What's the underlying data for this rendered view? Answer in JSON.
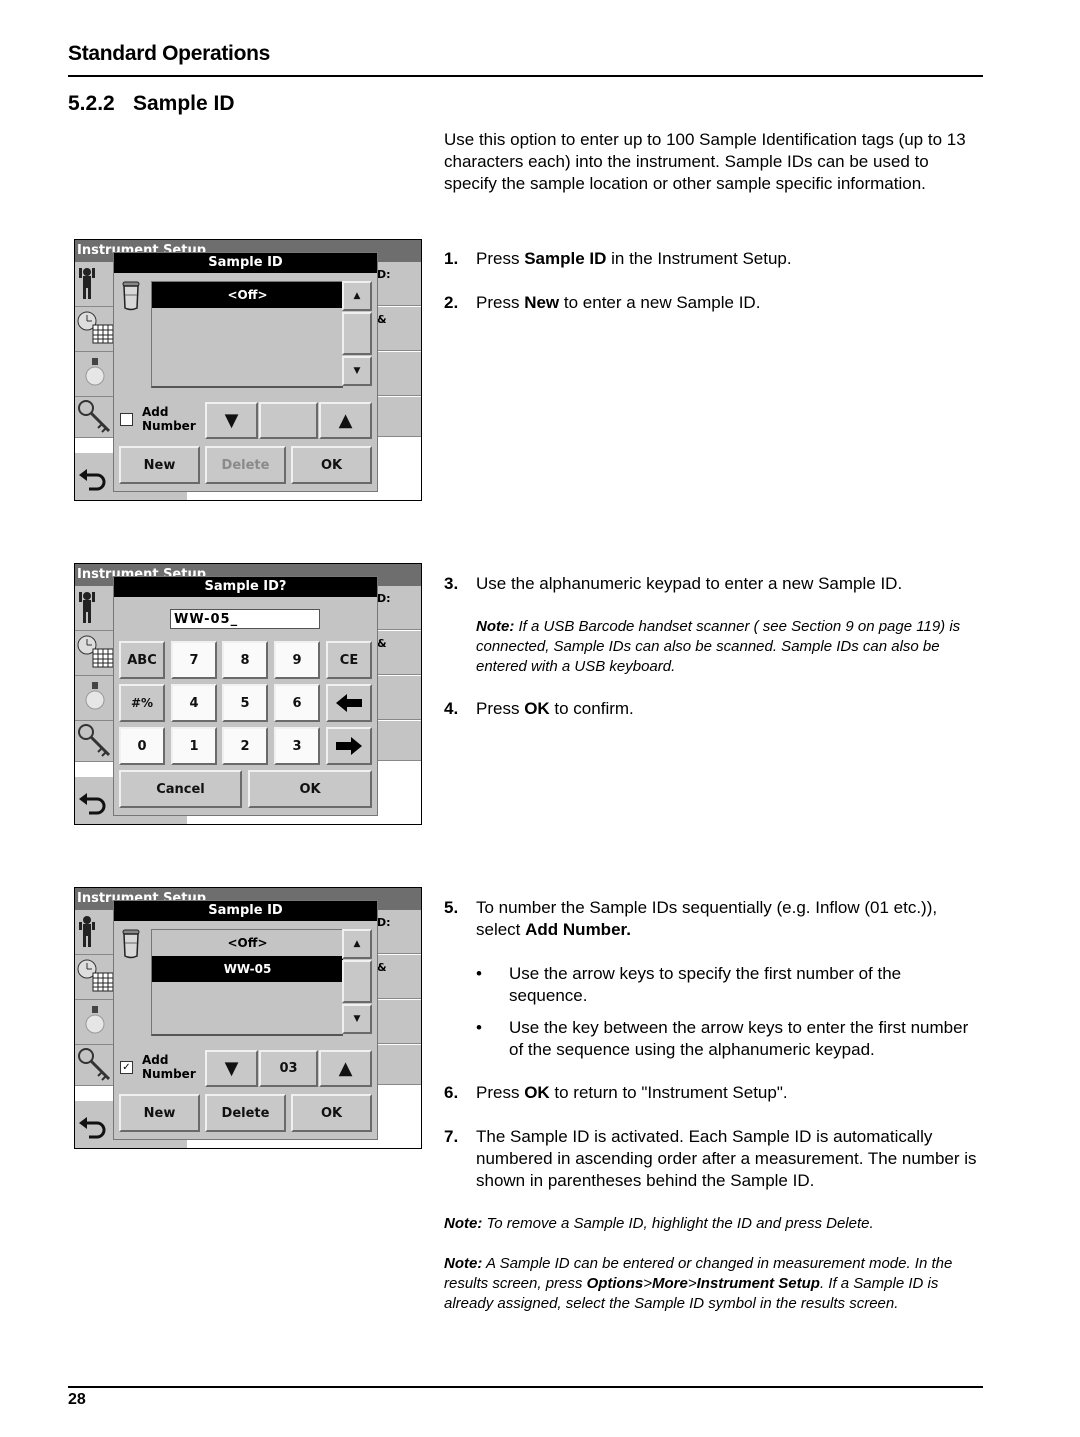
{
  "header": {
    "title": "Standard Operations"
  },
  "section": {
    "number": "5.2.2",
    "title": "Sample ID"
  },
  "intro": "Use this option to enter up to 100 Sample Identification tags (up to 13 characters each) into the instrument. Sample IDs can be used to specify the sample location or other sample specific information.",
  "steps": [
    {
      "num": "1.",
      "pre": "Press ",
      "bold": "Sample ID",
      "post": " in the Instrument Setup."
    },
    {
      "num": "2.",
      "pre": "Press ",
      "bold": "New",
      "post": " to enter a new Sample ID."
    },
    {
      "num": "3.",
      "text": "Use the alphanumeric keypad to enter a new Sample ID."
    },
    {
      "num": "4.",
      "pre": "Press ",
      "bold": "OK",
      "post": " to confirm."
    },
    {
      "num": "5.",
      "pre": "To number the Sample IDs sequentially (e.g. Inflow (01 etc.)), select ",
      "bold": "Add Number."
    },
    {
      "num": "6.",
      "pre": "Press ",
      "bold": "OK",
      "post": " to return to \"Instrument Setup\"."
    },
    {
      "num": "7.",
      "text": "The Sample ID is activated. Each Sample ID is automatically numbered in ascending order after a measurement. The number is shown in parentheses behind the Sample ID."
    }
  ],
  "bullets": [
    "Use the arrow keys to specify the first number of the sequence.",
    "Use the key between the arrow keys to enter the first number of the sequence using the alphanumeric keypad."
  ],
  "notes": {
    "label": "Note:",
    "barcode": "If a USB Barcode handset scanner ( see Section 9 on page 119) is connected, Sample IDs can also be scanned. Sample IDs can also be entered with a USB keyboard.",
    "remove": "To remove a Sample ID, highlight the ID and press Delete.",
    "measurement_pre": "A Sample ID can be entered or changed in measurement mode. In the results screen, press ",
    "menu_options": "Options",
    "sep": ">",
    "menu_more": "More",
    "menu_setup": "Instrument Setup",
    "measurement_post": ". If a Sample ID is already assigned, select the Sample ID symbol in the results screen."
  },
  "screens": {
    "background_title": "Instrument Setup",
    "right_cells": [
      "D:",
      "&"
    ],
    "screen1": {
      "dialog_title": "Sample ID",
      "list_items": [
        "<Off>"
      ],
      "selected_index": 0,
      "add_number_label_1": "Add",
      "add_number_label_2": "Number",
      "add_number_checked": false,
      "number_value": "",
      "buttons": {
        "new": "New",
        "delete": "Delete",
        "ok": "OK"
      },
      "delete_enabled": false
    },
    "screen2": {
      "dialog_title": "Sample ID?",
      "entry_value": "WW-05_",
      "keys_row1": [
        "ABC",
        "7",
        "8",
        "9",
        "CE"
      ],
      "keys_row2": [
        "#%",
        "4",
        "5",
        "6"
      ],
      "keys_row3": [
        "0",
        "1",
        "2",
        "3"
      ],
      "buttons": {
        "cancel": "Cancel",
        "ok": "OK"
      }
    },
    "screen3": {
      "dialog_title": "Sample ID",
      "list_items": [
        "<Off>",
        "WW-05"
      ],
      "selected_index": 1,
      "add_number_label_1": "Add",
      "add_number_label_2": "Number",
      "add_number_checked": true,
      "check_mark": "✓",
      "number_value": "03",
      "buttons": {
        "new": "New",
        "delete": "Delete",
        "ok": "OK"
      },
      "delete_enabled": true
    }
  },
  "footer": {
    "page_number": "28"
  }
}
